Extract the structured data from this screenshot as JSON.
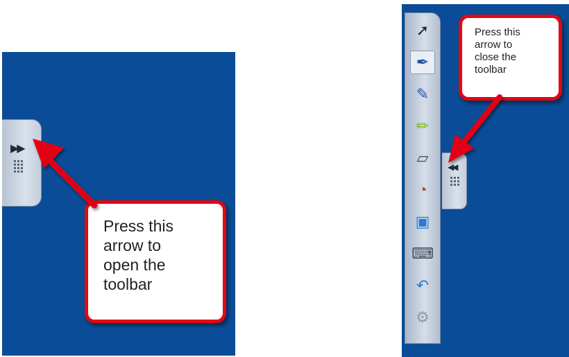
{
  "left_example": {
    "callout_lines": [
      "Press this",
      "arrow to",
      "open the",
      "toolbar"
    ],
    "tab_arrow": "▶▶"
  },
  "right_example": {
    "callout_lines": [
      "Press this",
      "arrow to",
      "close the",
      "toolbar"
    ],
    "tab_arrow": "◀◀",
    "toolbar_tools": [
      {
        "name": "select-arrow-icon",
        "glyph": "➚"
      },
      {
        "name": "pen-icon",
        "glyph": "✒",
        "active": true
      },
      {
        "name": "red-pen-icon",
        "glyph": "✎"
      },
      {
        "name": "highlighter-icon",
        "glyph": "✏"
      },
      {
        "name": "eraser-icon",
        "glyph": "▱"
      },
      {
        "name": "mouse-icon",
        "glyph": "◔"
      },
      {
        "name": "notebook-icon",
        "glyph": "▣"
      },
      {
        "name": "keyboard-icon",
        "glyph": "⌨"
      },
      {
        "name": "undo-icon",
        "glyph": "↶"
      },
      {
        "name": "settings-gear-icon",
        "glyph": "⚙"
      }
    ]
  },
  "colors": {
    "background_blue": "#0a4c97",
    "callout_border": "#e30613",
    "arrow_red": "#e30613"
  }
}
